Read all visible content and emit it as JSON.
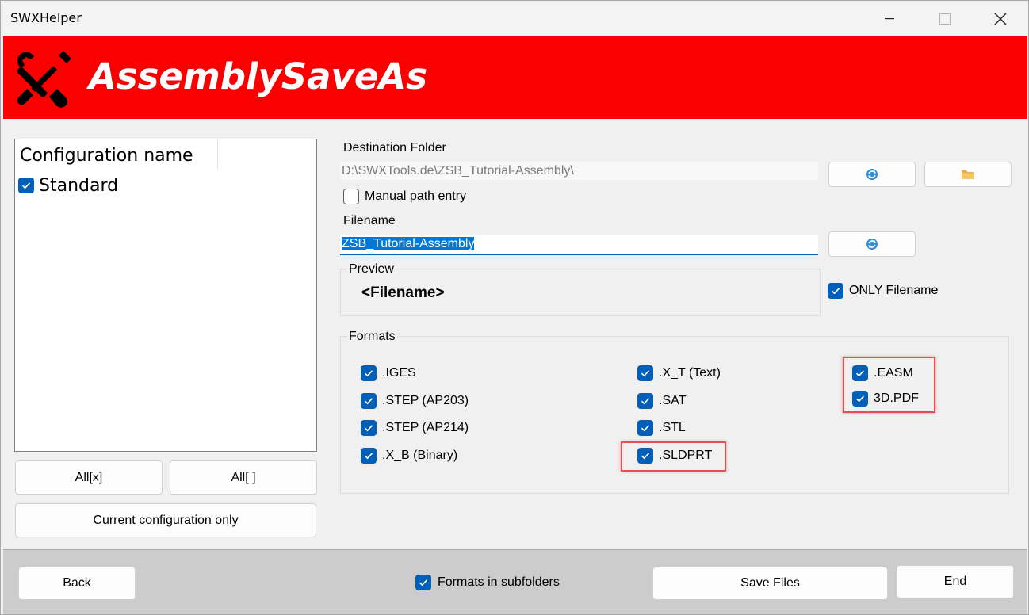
{
  "window": {
    "title": "SWXHelper"
  },
  "banner": {
    "title": "AssemblySaveAs",
    "icon": "tools-icon",
    "background": "#fa0000"
  },
  "config_list": {
    "header": "Configuration name",
    "items": [
      {
        "label": "Standard",
        "checked": true
      }
    ]
  },
  "buttons": {
    "select_all": "All[x]",
    "select_none": "All[ ]",
    "current_only": "Current configuration only",
    "back": "Back",
    "save_files": "Save Files",
    "end": "End"
  },
  "destination": {
    "label": "Destination Folder",
    "value": "D:\\SWXTools.de\\ZSB_Tutorial-Assembly\\",
    "manual_entry_label": "Manual path entry",
    "manual_entry_checked": false
  },
  "filename": {
    "label": "Filename",
    "value": "ZSB_Tutorial-Assembly"
  },
  "preview": {
    "label": "Preview",
    "value": "<Filename>",
    "only_filename_label": "ONLY Filename",
    "only_filename_checked": true
  },
  "formats": {
    "label": "Formats",
    "col1": [
      {
        "label": ".IGES",
        "checked": true
      },
      {
        "label": ".STEP (AP203)",
        "checked": true
      },
      {
        "label": ".STEP (AP214)",
        "checked": true
      },
      {
        "label": ".X_B (Binary)",
        "checked": true
      }
    ],
    "col2": [
      {
        "label": ".X_T (Text)",
        "checked": true
      },
      {
        "label": ".SAT",
        "checked": true
      },
      {
        "label": ".STL",
        "checked": true
      },
      {
        "label": ".SLDPRT",
        "checked": true
      }
    ],
    "col3": [
      {
        "label": ".EASM",
        "checked": true
      },
      {
        "label": "3D.PDF",
        "checked": true
      }
    ]
  },
  "footer": {
    "subfolders_label": "Formats in subfolders",
    "subfolders_checked": true
  },
  "colors": {
    "accent": "#005fb8",
    "highlight": "#e05050"
  }
}
